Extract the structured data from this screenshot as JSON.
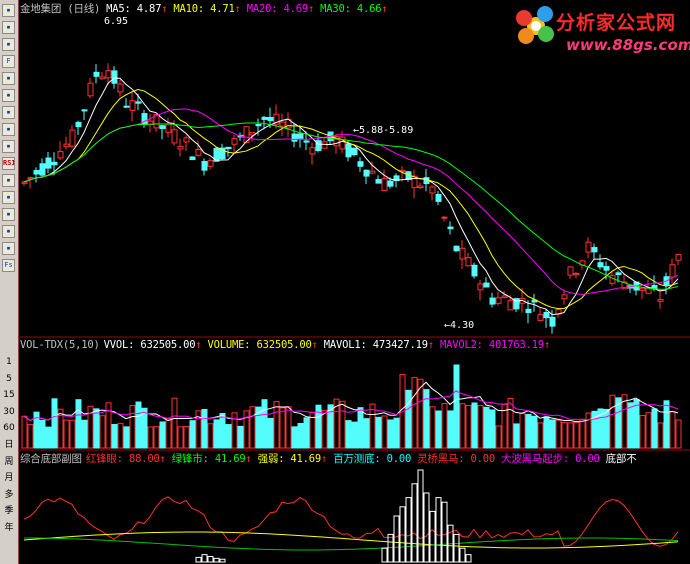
{
  "stock_name": "金地集团 (日线)",
  "price_header": [
    {
      "label": "MA5: ",
      "value": "4.87",
      "arrow": "↑",
      "color": "#ffffff"
    },
    {
      "label": "MA10: ",
      "value": "4.71",
      "arrow": "↑",
      "color": "#ffff00"
    },
    {
      "label": "MA20: ",
      "value": "4.69",
      "arrow": "↑",
      "color": "#ff00ff"
    },
    {
      "label": "MA30: ",
      "value": "4.66",
      "arrow": "↑",
      "color": "#00ff00"
    }
  ],
  "annotations": {
    "high": "6.95",
    "gap": "5.88-5.89",
    "low": "4.30"
  },
  "volume_header": {
    "title": "VOL-TDX(5,10)",
    "items": [
      {
        "label": "VVOL: ",
        "value": "632505.00",
        "arrow": "↑",
        "color": "#ffffff"
      },
      {
        "label": "VOLUME: ",
        "value": "632505.00",
        "arrow": "↑",
        "color": "#ffff00"
      },
      {
        "label": "MAVOL1: ",
        "value": "473427.19",
        "arrow": "↑",
        "color": "#ffffff"
      },
      {
        "label": "MAVOL2: ",
        "value": "401763.19",
        "arrow": "↑",
        "color": "#ff00ff"
      }
    ]
  },
  "indicator_header": {
    "title": "综合底部副图",
    "items": [
      {
        "label": "红锋眼: ",
        "value": "88.00",
        "arrow": "↑",
        "color": "#ff3030"
      },
      {
        "label": "绿锋市: ",
        "value": "41.69",
        "arrow": "↑",
        "color": "#00ff00"
      },
      {
        "label": "强弱: ",
        "value": "41.69",
        "arrow": "↑",
        "color": "#ffff00"
      },
      {
        "label": "百万测底: ",
        "value": "0.00",
        "arrow": "",
        "color": "#00ffff"
      },
      {
        "label": "灵桥黑马: ",
        "value": "0.00",
        "arrow": "",
        "color": "#ff3030"
      },
      {
        "label": "大波黑马起步: ",
        "value": "0.00",
        "arrow": "",
        "color": "#ff00ff"
      },
      {
        "label": "底部不",
        "value": "",
        "arrow": "",
        "color": "#ffffff"
      }
    ]
  },
  "logo": {
    "title": "分析家公式网",
    "url": "www.88gs.com"
  },
  "sidebar_labels": [
    "1",
    "5",
    "15",
    "30",
    "60",
    "日",
    "周",
    "月",
    "多",
    "季",
    "年"
  ],
  "sidebar_icons": [
    "cursor",
    "zoom-in",
    "zoom-out",
    "f10",
    "tick",
    "min",
    "kline",
    "draw",
    "info",
    "rsi",
    "ind",
    "exp",
    "back",
    "fwd",
    "note",
    "fs"
  ],
  "chart_data": {
    "type": "candlestick",
    "series_names": [
      "MA5",
      "MA10",
      "MA20",
      "MA30"
    ],
    "price_high": 6.95,
    "price_low": 4.3,
    "last_close": 4.87
  },
  "colors": {
    "up": "#ff3232",
    "down": "#54fcfc",
    "ma5": "#ffffff",
    "ma10": "#ffff00",
    "ma20": "#ff00ff",
    "ma30": "#00ff00"
  }
}
